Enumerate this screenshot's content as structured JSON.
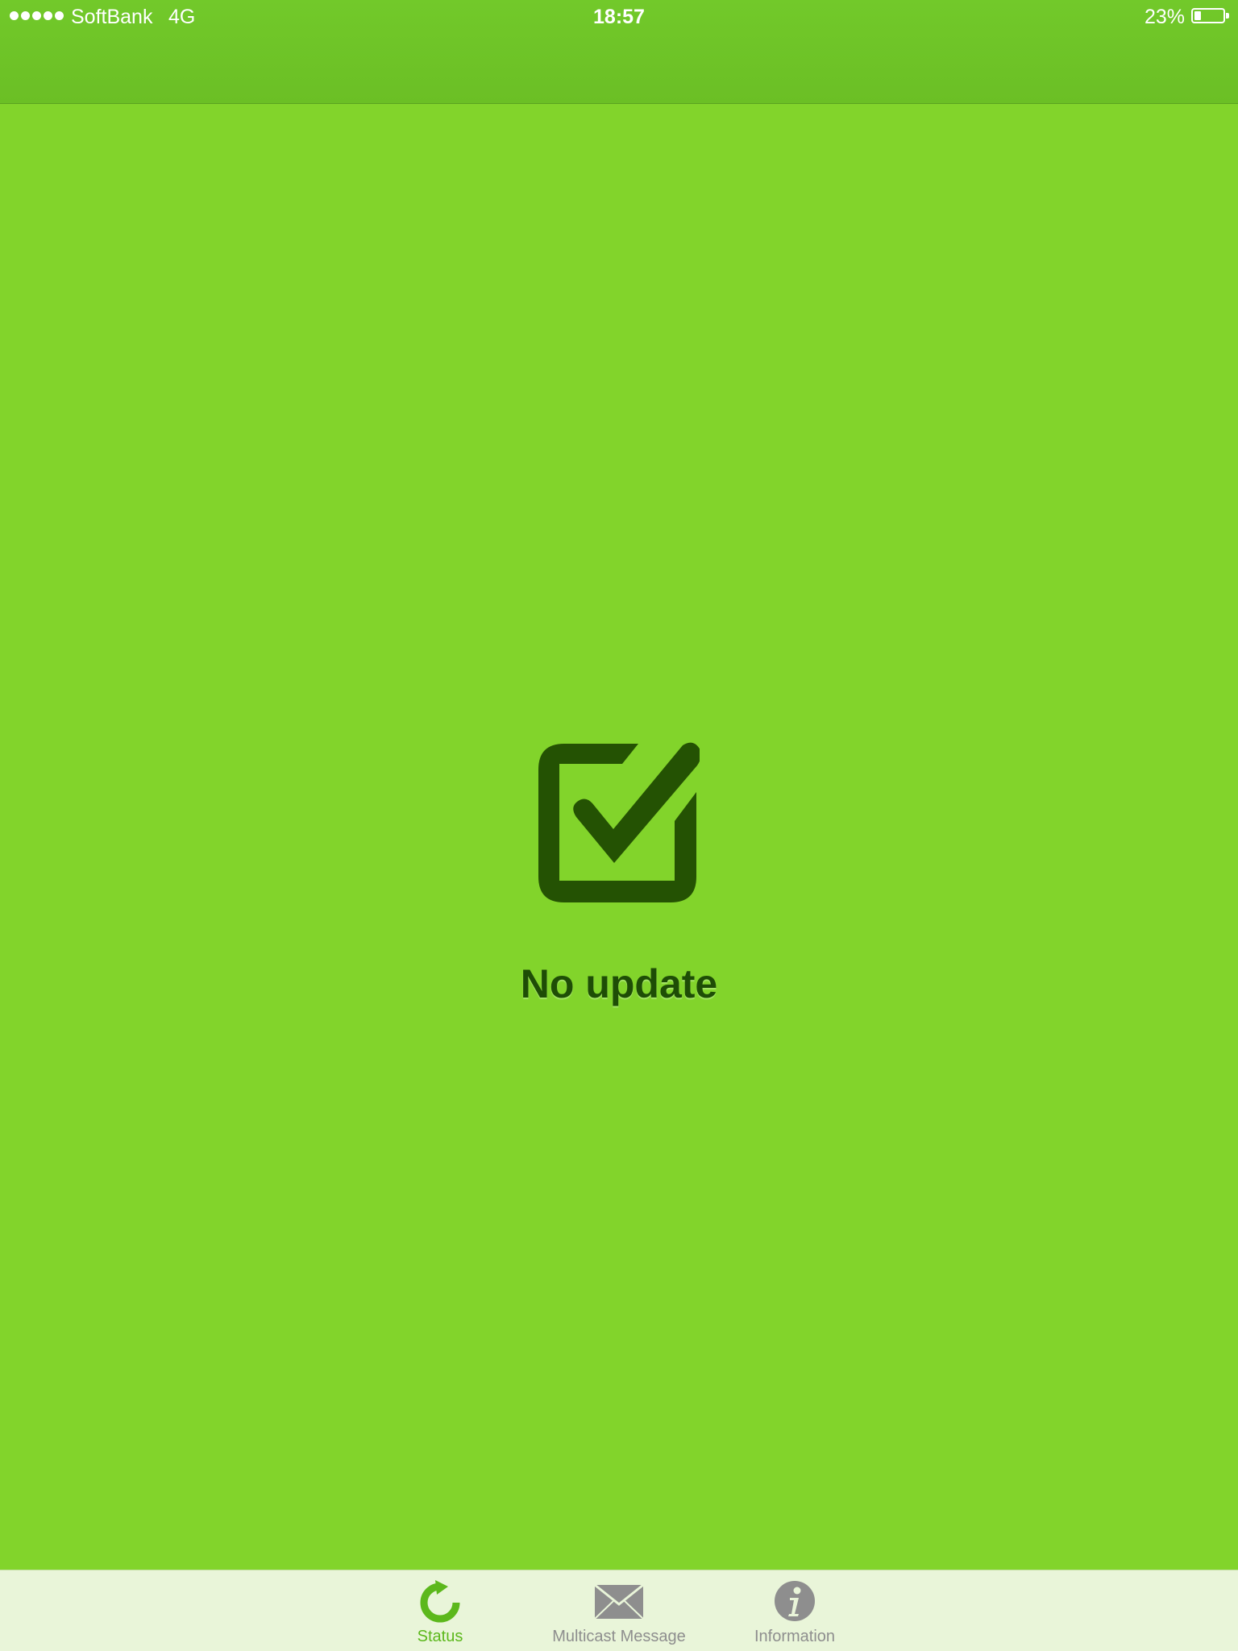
{
  "status_bar": {
    "carrier": "SoftBank",
    "network": "4G",
    "time": "18:57",
    "battery_percent": "23%",
    "battery_level": 0.23,
    "signal_bars": 5
  },
  "main": {
    "status_icon": "checkbox-checked-icon",
    "message": "No update"
  },
  "tab_bar": {
    "tabs": [
      {
        "label": "Status",
        "icon": "refresh-icon",
        "selected": true
      },
      {
        "label": "Multicast Message",
        "icon": "envelope-icon",
        "selected": false
      },
      {
        "label": "Information",
        "icon": "info-icon",
        "selected": false
      }
    ]
  },
  "colors": {
    "background": "#82d42b",
    "header": "#6bbf25",
    "icon_dark": "#245203",
    "message_text": "#1e4d06",
    "tab_bar": "#e9f5d9",
    "tab_active": "#5cb81c",
    "tab_inactive": "#8e8e8e"
  }
}
